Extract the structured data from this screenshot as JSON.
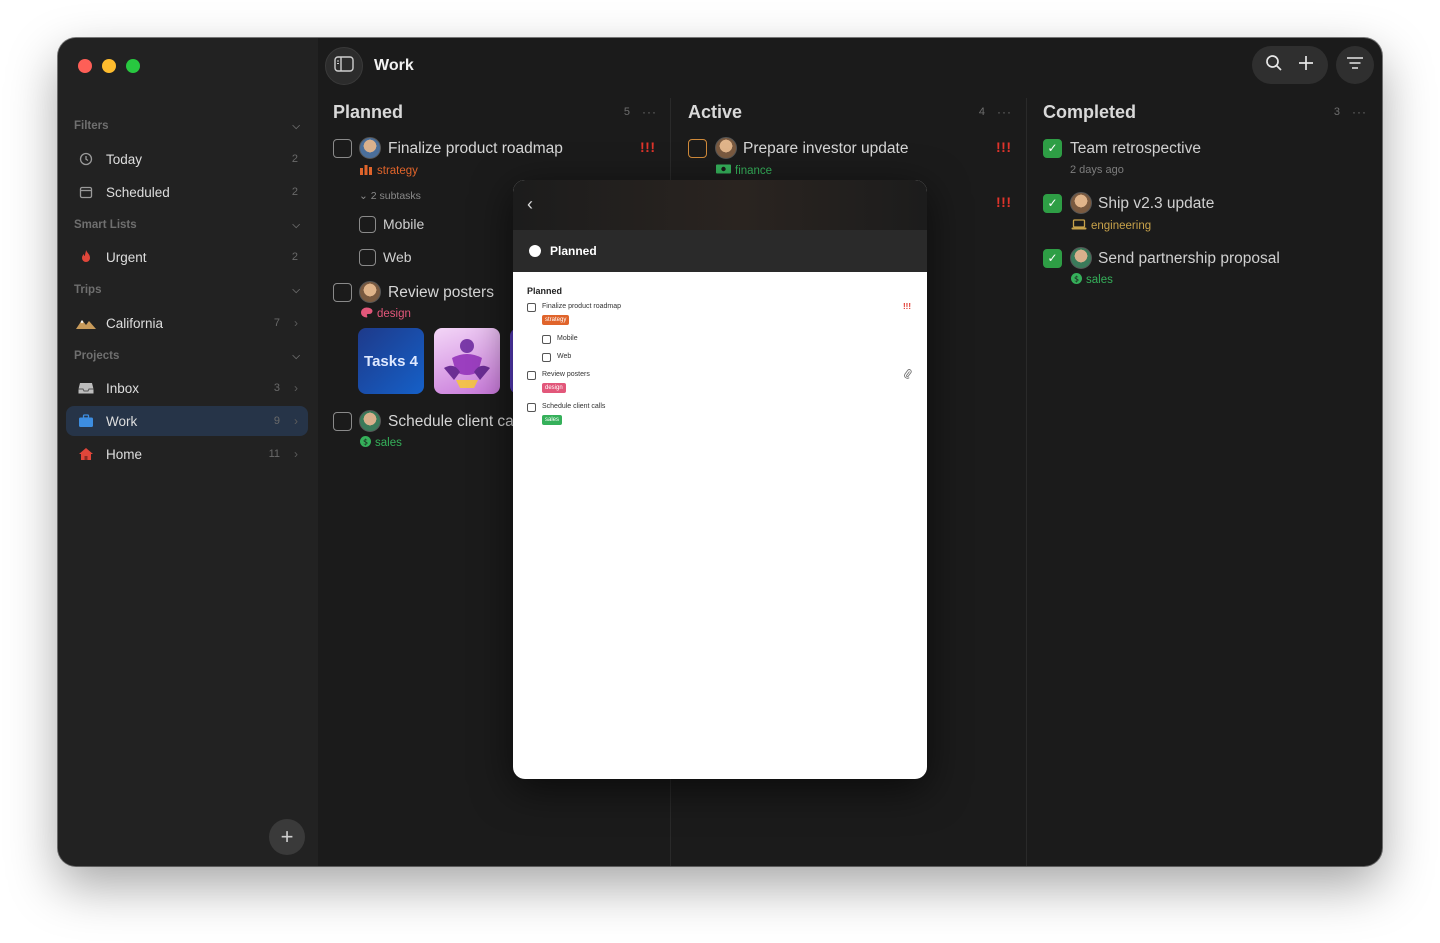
{
  "window": {
    "title": "Work"
  },
  "sidebar": {
    "sections": {
      "filters": "Filters",
      "smart_lists": "Smart Lists",
      "trips": "Trips",
      "projects": "Projects"
    },
    "items": [
      {
        "label": "Today",
        "count": "2",
        "icon": "clock-icon"
      },
      {
        "label": "Scheduled",
        "count": "2",
        "icon": "calendar-icon"
      },
      {
        "label": "Urgent",
        "count": "2",
        "icon": "fire-icon"
      },
      {
        "label": "California",
        "count": "7",
        "icon": "mountain-icon"
      },
      {
        "label": "Inbox",
        "count": "3",
        "icon": "inbox-icon"
      },
      {
        "label": "Work",
        "count": "9",
        "icon": "briefcase-icon"
      },
      {
        "label": "Home",
        "count": "11",
        "icon": "house-icon"
      }
    ],
    "add_label": "+"
  },
  "columns": {
    "planned": {
      "name": "Planned",
      "count": "5",
      "more": "···"
    },
    "active": {
      "name": "Active",
      "count": "4",
      "more": "···"
    },
    "completed": {
      "name": "Completed",
      "count": "3",
      "more": "···"
    }
  },
  "planned_tasks": {
    "t1": {
      "title": "Finalize product roadmap",
      "tag": "strategy",
      "priority": "!!!",
      "subtasks_label": "2 subtasks",
      "subtasks": [
        "Mobile",
        "Web"
      ]
    },
    "t2": {
      "title": "Review posters",
      "tag": "design",
      "thumb_text": "Tasks 4"
    },
    "t3": {
      "title": "Schedule client ca",
      "tag": "sales"
    }
  },
  "active_tasks": {
    "t1": {
      "title": "Prepare investor update",
      "tag": "finance",
      "priority": "!!!"
    },
    "t2": {
      "priority": "!!!"
    }
  },
  "completed_tasks": {
    "t1": {
      "title": "Team retrospective",
      "meta": "2 days ago"
    },
    "t2": {
      "title": "Ship v2.3 update",
      "tag": "engineering"
    },
    "t3": {
      "title": "Send partnership proposal",
      "tag": "sales"
    }
  },
  "overlay": {
    "bar_label": "Planned",
    "heading": "Planned",
    "items": {
      "i1": {
        "title": "Finalize product roadmap",
        "tag": "strategy",
        "priority": "!!!"
      },
      "i1_sub1": "Mobile",
      "i1_sub2": "Web",
      "i2": {
        "title": "Review posters",
        "tag": "design"
      },
      "i3": {
        "title": "Schedule client calls",
        "tag": "sales"
      }
    }
  },
  "colors": {
    "strategy": "#e0642b",
    "design": "#e2577a",
    "sales": "#35b05a",
    "finance": "#35b05a",
    "engineering": "#c8a24a",
    "priority": "#e0342b"
  }
}
